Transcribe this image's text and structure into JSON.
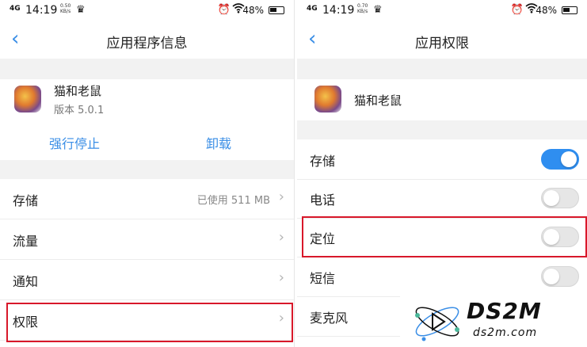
{
  "status_left": {
    "signal": "4G",
    "time": "14:19",
    "speed": "0.50\nKB/s",
    "battery": "48%"
  },
  "status_right": {
    "signal": "4G",
    "time": "14:19",
    "speed": "0.70\nKB/s",
    "battery": "48%"
  },
  "left": {
    "title": "应用程序信息",
    "app_name": "猫和老鼠",
    "app_version": "版本 5.0.1",
    "force_stop": "强行停止",
    "uninstall": "卸载",
    "rows": [
      {
        "label": "存储",
        "value": "已使用 511 MB"
      },
      {
        "label": "流量",
        "value": ""
      },
      {
        "label": "通知",
        "value": ""
      },
      {
        "label": "权限",
        "value": ""
      }
    ]
  },
  "right": {
    "title": "应用权限",
    "app_name": "猫和老鼠",
    "permissions": [
      {
        "label": "存储",
        "enabled": true
      },
      {
        "label": "电话",
        "enabled": false
      },
      {
        "label": "定位",
        "enabled": false
      },
      {
        "label": "短信",
        "enabled": false
      },
      {
        "label": "麦克风",
        "enabled": false
      }
    ]
  },
  "watermark": {
    "title": "DS2M",
    "url": "ds2m.com"
  },
  "colors": {
    "accent": "#3a8ee6",
    "toggle_on": "#2f8ef0",
    "highlight": "#d8182a"
  },
  "icons": [
    "back-chevron-icon",
    "chevron-right-icon",
    "alarm-icon",
    "wifi-icon",
    "battery-icon",
    "crown-icon",
    "app-icon"
  ]
}
